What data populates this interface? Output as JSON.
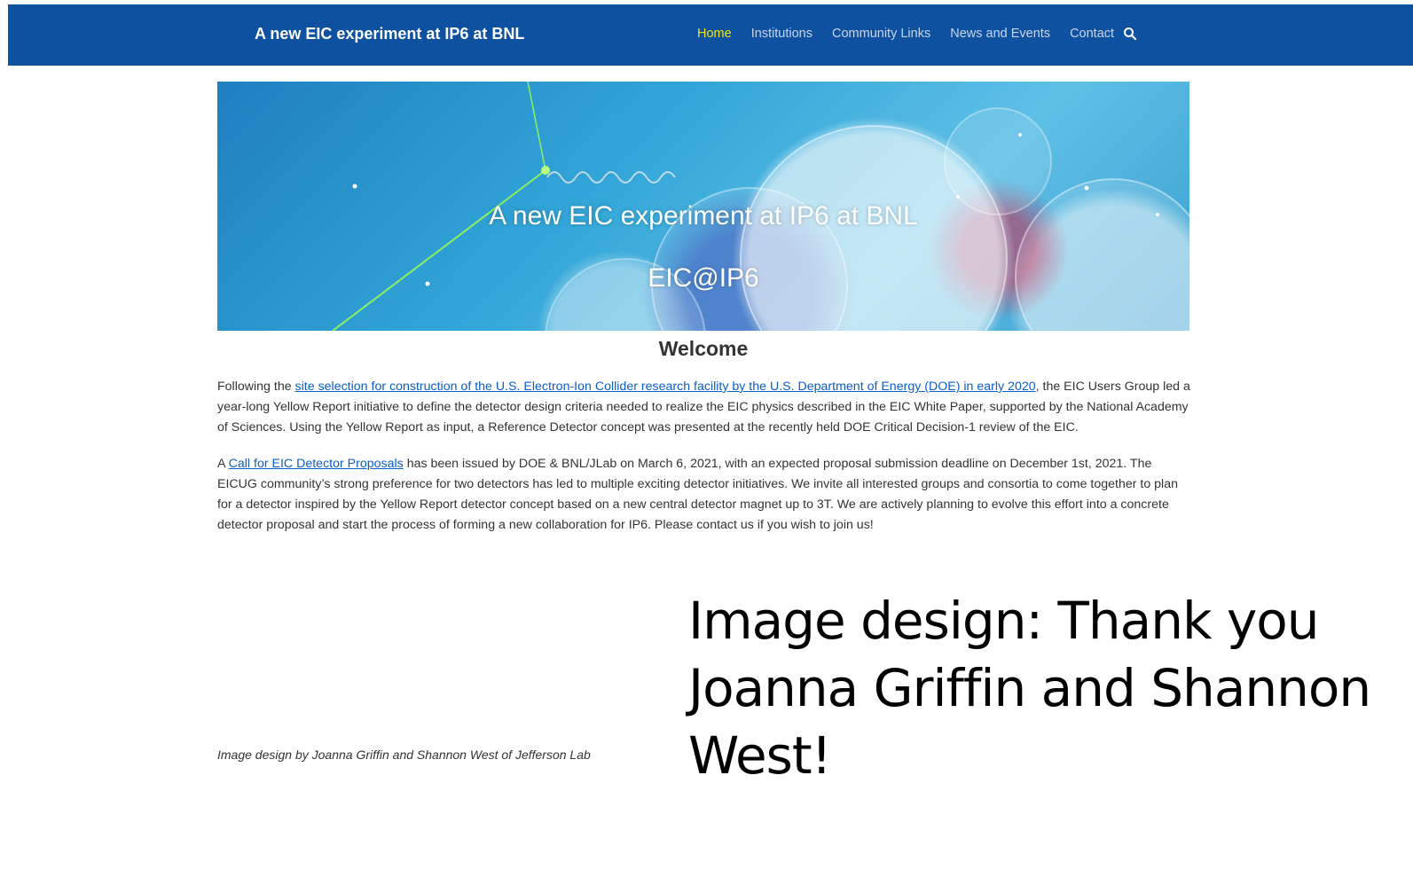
{
  "header": {
    "site_title": "A new EIC experiment at IP6 at BNL",
    "nav": [
      {
        "label": "Home",
        "active": true
      },
      {
        "label": "Institutions",
        "active": false
      },
      {
        "label": "Community Links",
        "active": false
      },
      {
        "label": "News and Events",
        "active": false
      },
      {
        "label": "Contact",
        "active": false
      }
    ],
    "search_icon": "search-icon"
  },
  "hero": {
    "title": "A new EIC experiment at IP6 at BNL",
    "subtitle": "EIC@IP6"
  },
  "welcome": "Welcome",
  "paragraph1": {
    "pre": "Following the ",
    "link": "site selection for construction of the U.S. Electron-Ion Collider research facility by the U.S. Department of Energy (DOE) in early 2020",
    "post": ", the EIC Users Group led a year-long Yellow Report initiative to define the detector design criteria needed to realize the EIC physics described in the EIC White Paper, supported by the National Academy of Sciences. Using the Yellow Report as input, a Reference Detector concept was presented at the recently held DOE Critical Decision-1 review of the EIC."
  },
  "paragraph2": {
    "pre": "A ",
    "link": "Call for EIC Detector Proposals",
    "post": " has been issued by DOE & BNL/JLab on March 6, 2021, with an expected proposal submission deadline on December 1st, 2021. The EICUG community’s strong preference for two detectors has led to multiple exciting detector initiatives. We invite all interested groups and consortia to come together to plan for a detector inspired by the Yellow Report detector concept based on a new central detector magnet up to 3T. We are actively planning to evolve this effort into a concrete detector proposal and start the process of forming a new collaboration for IP6. Please contact us if you wish to join us!"
  },
  "caption": "Image design by Joanna Griffin and Shannon West of Jefferson Lab",
  "credit_text": "Image design: Thank you Joanna Griffin and Shannon West!",
  "colors": {
    "header_bg": "#0d51a0",
    "nav_active": "#f2e417",
    "nav_text": "#c9d6ea",
    "link": "#0d5ec9",
    "text": "#333333"
  }
}
